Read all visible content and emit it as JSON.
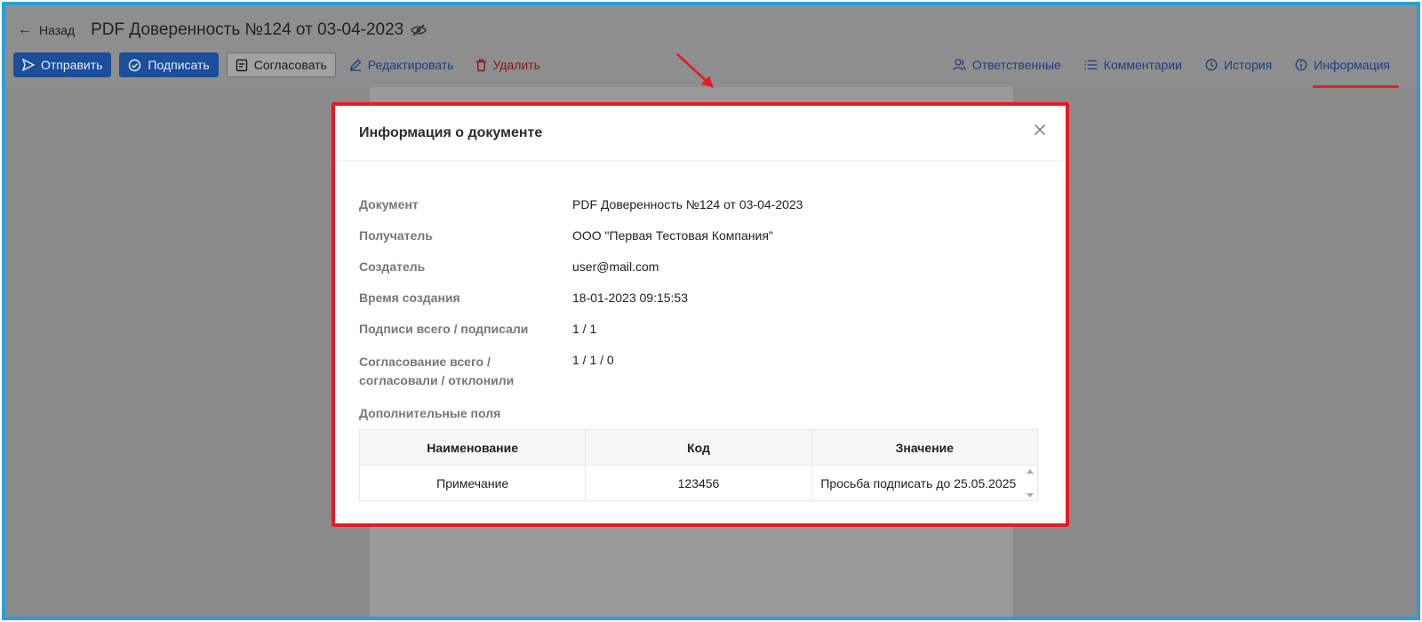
{
  "header": {
    "back_label": "Назад",
    "title": "PDF Доверенность №124 от 03-04-2023"
  },
  "toolbar": {
    "send_label": "Отправить",
    "sign_label": "Подписать",
    "approve_label": "Согласовать",
    "edit_label": "Редактировать",
    "delete_label": "Удалить"
  },
  "right_nav": {
    "responsible_label": "Ответственные",
    "comments_label": "Комментарии",
    "history_label": "История",
    "info_label": "Информация"
  },
  "modal": {
    "title": "Информация о документе",
    "rows": [
      {
        "label": "Документ",
        "value": "PDF Доверенность №124 от 03-04-2023"
      },
      {
        "label": "Получатель",
        "value": "ООО \"Первая Тестовая Компания\""
      },
      {
        "label": "Создатель",
        "value": "user@mail.com"
      },
      {
        "label": "Время создания",
        "value": "18-01-2023 09:15:53"
      },
      {
        "label": "Подписи всего / подписали",
        "value": "1 / 1"
      },
      {
        "label": "Согласование всего / согласовали / отклонили",
        "value": "1 / 1 / 0"
      }
    ],
    "extra_fields_label": "Дополнительные поля",
    "table": {
      "headers": [
        "Наименование",
        "Код",
        "Значение"
      ],
      "rows": [
        [
          "Примечание",
          "123456",
          "Просьба подписать до 25.05.2025"
        ]
      ]
    }
  },
  "colors": {
    "accent": "#1b4e9b",
    "annotation": "#e31b23",
    "frame": "#2a9fd8"
  }
}
